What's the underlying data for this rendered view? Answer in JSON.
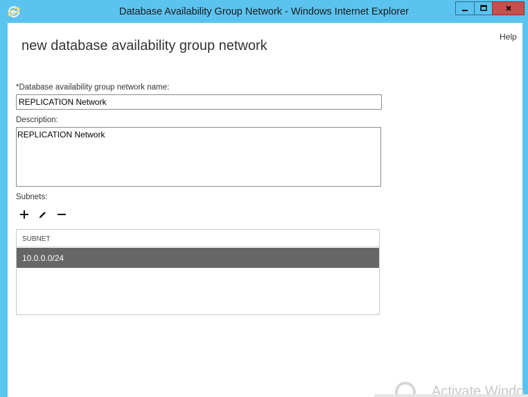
{
  "window": {
    "title": "Database Availability Group Network - Windows Internet Explorer",
    "buttons": {
      "minimize_icon": "minimize-icon",
      "maximize_icon": "maximize-icon",
      "close_icon": "close-icon"
    },
    "accent_color": "#5bc3ef",
    "close_color": "#c7504a"
  },
  "header": {
    "help_label": "Help",
    "title": "new database availability group network"
  },
  "form": {
    "name_label": "*Database availability group network name:",
    "name_value": "REPLICATION Network",
    "description_label": "Description:",
    "description_value": "REPLICATION Network",
    "subnets_label": "Subnets:"
  },
  "toolbar": {
    "add_icon": "plus-icon",
    "edit_icon": "pencil-icon",
    "remove_icon": "minus-icon"
  },
  "subnets_table": {
    "columns": [
      "SUBNET"
    ],
    "rows": [
      {
        "subnet": "10.0.0.0/24",
        "selected": true
      }
    ],
    "selected_row_color": "#666666"
  },
  "watermark": {
    "text": "Activate Windo"
  }
}
